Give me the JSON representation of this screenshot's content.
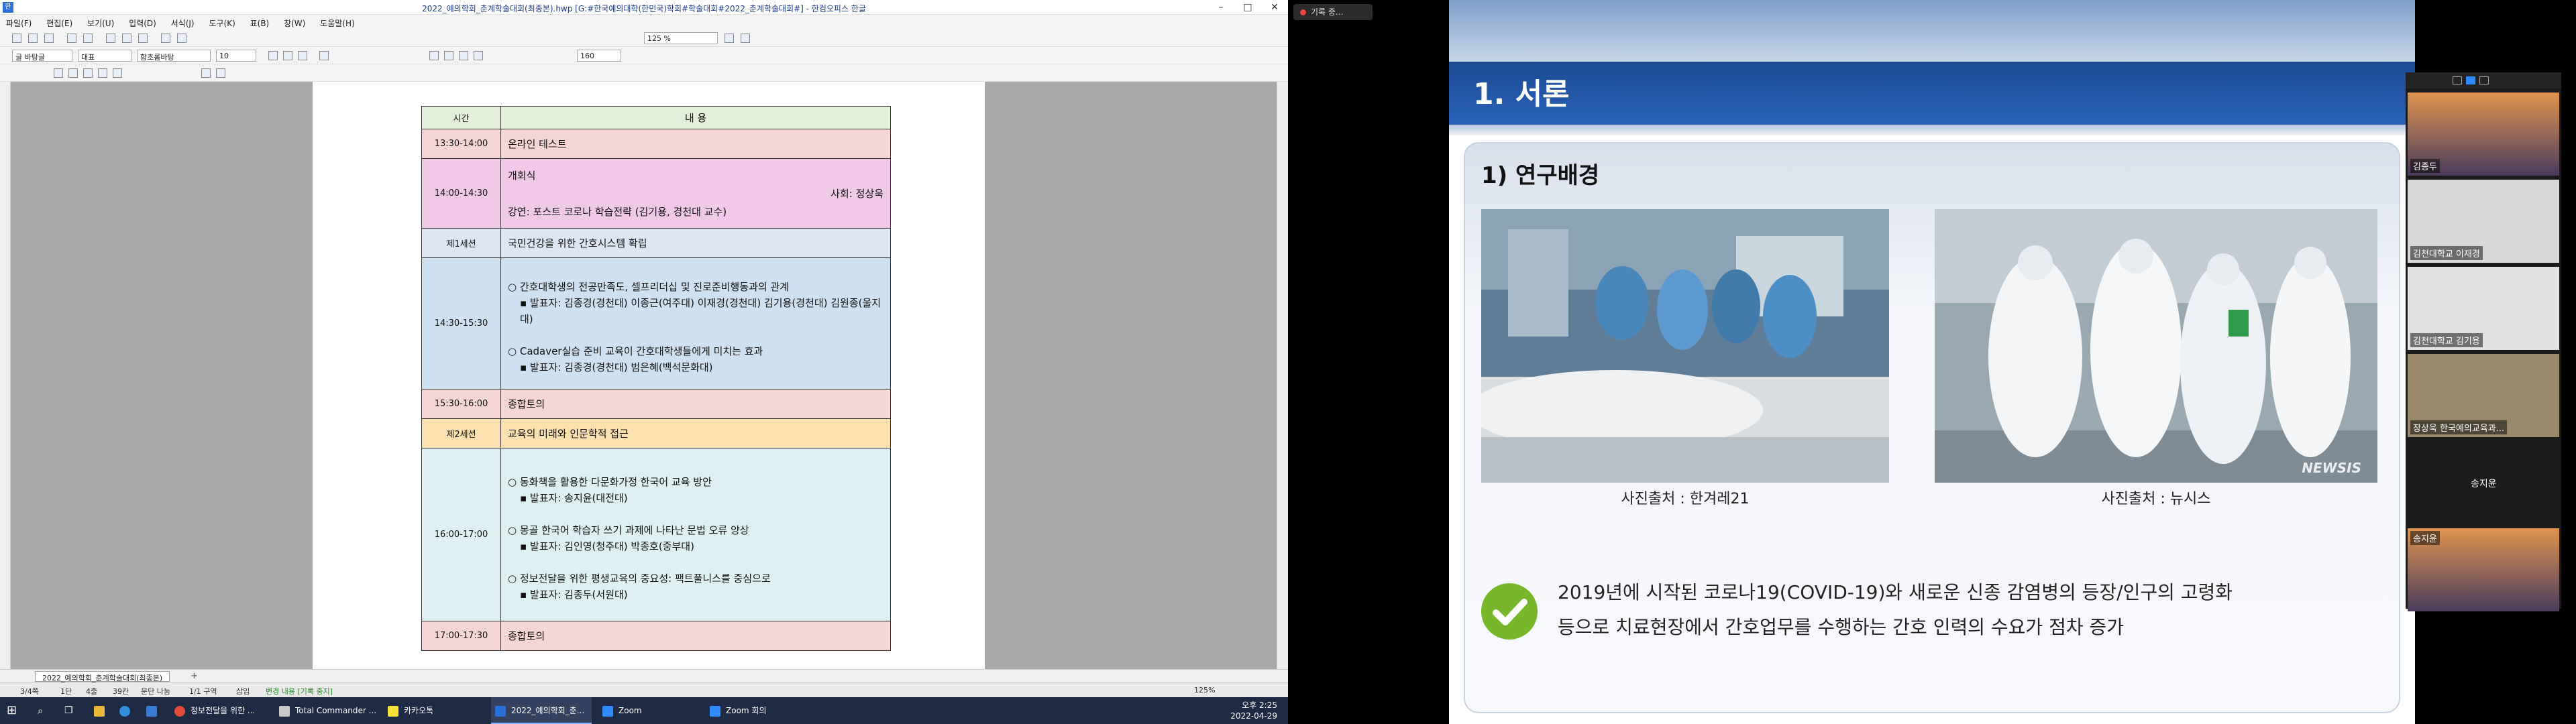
{
  "editor": {
    "title": "2022_예의학회_춘계학술대회(최종본).hwp [G:#한국예의대학(한민국)학회#학술대회#2022_춘계학술대회#] - 한컴오피스 한글",
    "app_icon_text": "한",
    "menu": [
      "파일(F)",
      "편집(E)",
      "보기(U)",
      "입력(D)",
      "서식(J)",
      "도구(K)",
      "표(B)",
      "창(W)",
      "도움말(H)"
    ],
    "toolbar": {
      "style_select": "글 바탕글",
      "font_select": "대표",
      "font2_select": "함초롬바탕",
      "size_select": "10",
      "zoom_select": "125 %",
      "pct_select": "160"
    },
    "sheet_tab": "2022_예의학회_춘계학술대회(최종본)",
    "status": {
      "page": "3/4쪽",
      "section": "1단",
      "line": "4줄",
      "col": "39칸",
      "mode": "문단 나눔",
      "sect": "1/1 구역",
      "insert": "삽입",
      "track": "변경 내용 [기록 중지]",
      "zoom": "125%"
    },
    "table": {
      "header": {
        "time": "시간",
        "content": "내 용"
      },
      "rows": [
        {
          "time": "13:30-14:00",
          "lines": [
            "온라인 테스트"
          ]
        },
        {
          "time": "14:00-14:30",
          "opening": "개회식",
          "host": "사회: 정상욱",
          "talk": "강연: 포스트 코로나 학습전략 (김기용, 경천대 교수)"
        },
        {
          "time": "제1세션",
          "lines": [
            "국민건강을 위한 간호시스템 확립"
          ]
        },
        {
          "time": "14:30-15:30",
          "items": [
            {
              "title": "○ 간호대학생의 전공만족도, 셀프리더십 및 진로준비행동과의 관계",
              "presenter": "▪ 발표자: 김종경(경천대) 이종근(여주대) 이재경(경천대) 김기용(경천대) 김원종(울지대)"
            },
            {
              "title": "○ Cadaver실습 준비 교육이 간호대학생들에게 미치는 효과",
              "presenter": "▪ 발표자: 김종경(경천대) 범은혜(백석문화대)"
            }
          ]
        },
        {
          "time": "15:30-16:00",
          "lines": [
            "종합토의"
          ]
        },
        {
          "time": "제2세션",
          "lines": [
            "교육의 미래와 인문학적 접근"
          ]
        },
        {
          "time": "16:00-17:00",
          "items": [
            {
              "title": "○ 동화책을 활용한 다문화가정 한국어 교육 방안",
              "presenter": "▪ 발표자: 송지윤(대전대)"
            },
            {
              "title": "○ 몽골 한국어 학습자 쓰기 과제에 나타난 문법 오류 양상",
              "presenter": "▪ 발표자: 김인영(청주대) 박종호(중부대)"
            },
            {
              "title": "○ 정보전달을 위한 평생교육의 중요성: 팩트풀니스를 중심으로",
              "presenter": "▪ 발표자: 김종두(서원대)"
            }
          ]
        },
        {
          "time": "17:00-17:30",
          "lines": [
            "종합토의"
          ]
        }
      ]
    }
  },
  "taskbar": {
    "items": [
      "정보전달을 위한 ...",
      "Total Commander ...",
      "카카오톡",
      "2022_예의학회_춘...",
      "Zoom",
      "Zoom 회의"
    ],
    "time": "오후 2:25",
    "date": "2022-04-29"
  },
  "zoom": {
    "record_label": "기록 중...",
    "slide": {
      "title": "1. 서론",
      "section": "1) 연구배경",
      "caption_left": "사진출처 : 한겨레21",
      "caption_right": "사진출처 : 뉴시스",
      "watermark": "NEWSIS",
      "summary_line1": "2019년에 시작된 코로나19(COVID-19)와 새로운 신종 감염병의 등장/인구의 고령화",
      "summary_line2": "등으로 치료현장에서 간호업무를 수행하는 간호 인력의 수요가 점차 증가"
    },
    "participants": [
      "김종두",
      "김천대학교 이재경",
      "김천대학교 김기용",
      "장상욱 한국예의교육과...",
      "송지윤",
      "송지윤"
    ]
  }
}
